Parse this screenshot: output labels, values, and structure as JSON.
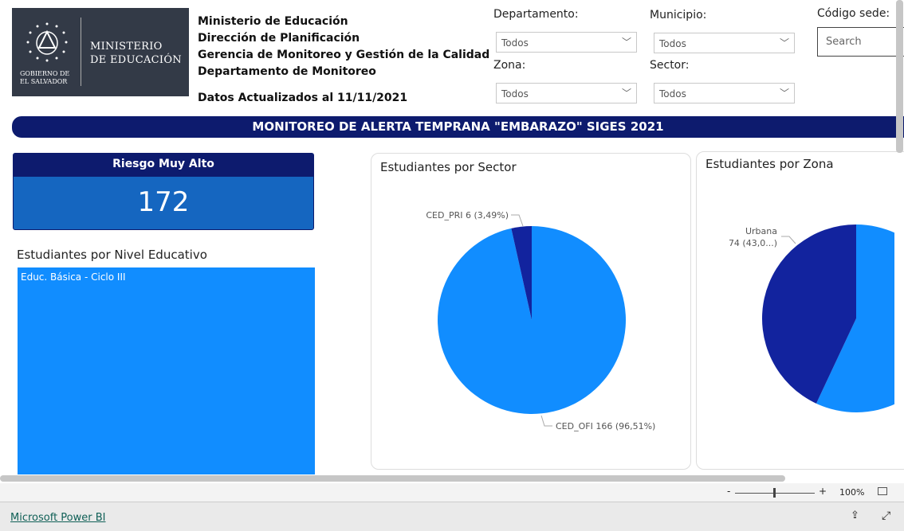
{
  "logo": {
    "line1": "MINISTERIO",
    "line2": "DE EDUCACIÓN",
    "gov1": "GOBIERNO DE",
    "gov2": "EL SALVADOR"
  },
  "header": {
    "lines": [
      "Ministerio de Educación",
      "Dirección de Planificación",
      "Gerencia de Monitoreo y Gestión de la Calidad",
      "Departamento de Monitoreo"
    ],
    "updated": "Datos Actualizados al 11/11/2021"
  },
  "filters": {
    "departamento": {
      "label": "Departamento:",
      "value": "Todos"
    },
    "municipio": {
      "label": "Municipio:",
      "value": "Todos"
    },
    "zona": {
      "label": "Zona:",
      "value": "Todos"
    },
    "sector": {
      "label": "Sector:",
      "value": "Todos"
    },
    "codigo": {
      "label": "Código sede:",
      "placeholder": "Search"
    }
  },
  "banner": "MONITOREO DE ALERTA TEMPRANA \"EMBARAZO\" SIGES 2021",
  "kpi": {
    "title": "Riesgo Muy Alto",
    "value": "172"
  },
  "nivel": {
    "title": "Estudiantes por Nivel Educativo",
    "item": "Educ. Básica - Ciclo III",
    "color": "#118dff"
  },
  "chart_data": [
    {
      "type": "pie",
      "title": "Estudiantes por Sector",
      "slices": [
        {
          "label": "CED_PRI",
          "value": 6,
          "pct": "3,49%",
          "color": "#12239e"
        },
        {
          "label": "CED_OFI",
          "value": 166,
          "pct": "96,51%",
          "color": "#118dff"
        }
      ],
      "labels": [
        "CED_PRI 6 (3,49%)",
        "CED_OFI 166 (96,51%)"
      ]
    },
    {
      "type": "pie",
      "title": "Estudiantes por Zona",
      "slices": [
        {
          "label": "Urbana",
          "value": 74,
          "pct": "43,0...",
          "color": "#12239e"
        },
        {
          "value": 98,
          "color": "#118dff"
        }
      ],
      "labels": [
        "Urbana",
        "74 (43,0...)"
      ]
    }
  ],
  "zoom": {
    "minus": "-",
    "plus": "+",
    "level": "100%",
    "value": 100
  },
  "footer": {
    "link": "Microsoft Power BI"
  }
}
